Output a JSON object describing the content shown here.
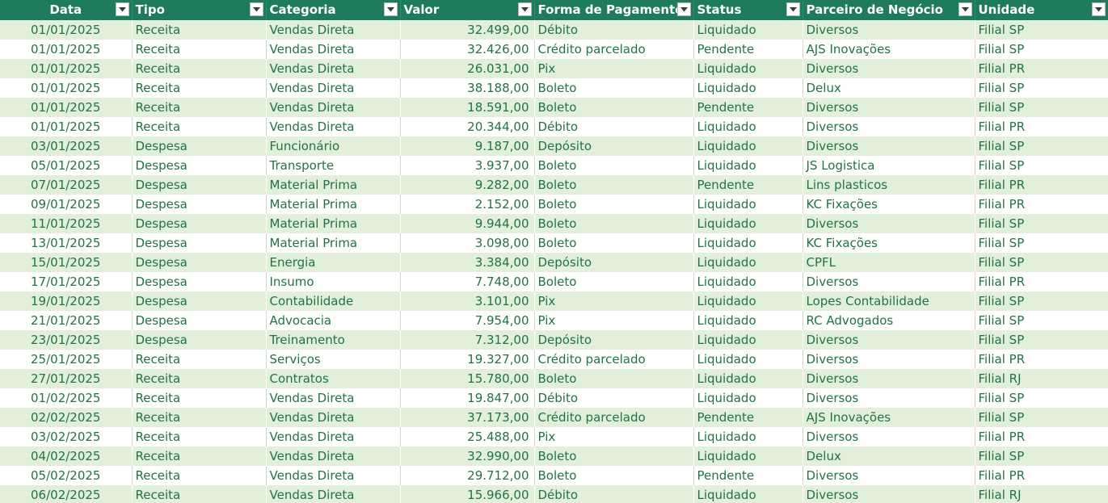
{
  "colors": {
    "header_bg": "#1e7b5e",
    "header_text": "#ffffff",
    "row_band": "#e2efda",
    "row_plain": "#ffffff",
    "cell_text": "#217346"
  },
  "table": {
    "headers": [
      "Data",
      "Tipo",
      "Categoria",
      "Valor",
      "Forma de Pagamento",
      "Status",
      "Parceiro de Negócio",
      "Unidade"
    ],
    "filter_icon": "dropdown-arrow-icon",
    "rows": [
      [
        "01/01/2025",
        "Receita",
        "Vendas Direta",
        "32.499,00",
        "Débito",
        "Liquidado",
        "Diversos",
        "Filial SP"
      ],
      [
        "01/01/2025",
        "Receita",
        "Vendas Direta",
        "32.426,00",
        "Crédito parcelado",
        "Pendente",
        "AJS Inovações",
        "Filial SP"
      ],
      [
        "01/01/2025",
        "Receita",
        "Vendas Direta",
        "26.031,00",
        "Pix",
        "Liquidado",
        "Diversos",
        "Filial PR"
      ],
      [
        "01/01/2025",
        "Receita",
        "Vendas Direta",
        "38.188,00",
        "Boleto",
        "Liquidado",
        "Delux",
        "Filial SP"
      ],
      [
        "01/01/2025",
        "Receita",
        "Vendas Direta",
        "18.591,00",
        "Boleto",
        "Pendente",
        "Diversos",
        "Filial SP"
      ],
      [
        "01/01/2025",
        "Receita",
        "Vendas Direta",
        "20.344,00",
        "Débito",
        "Liquidado",
        "Diversos",
        "Filial PR"
      ],
      [
        "03/01/2025",
        "Despesa",
        "Funcionário",
        "9.187,00",
        "Depósito",
        "Liquidado",
        "Diversos",
        "Filial SP"
      ],
      [
        "05/01/2025",
        "Despesa",
        "Transporte",
        "3.937,00",
        "Boleto",
        "Liquidado",
        "JS Logistica",
        "Filial SP"
      ],
      [
        "07/01/2025",
        "Despesa",
        "Material Prima",
        "9.282,00",
        "Boleto",
        "Pendente",
        "Lins plasticos",
        "Filial PR"
      ],
      [
        "09/01/2025",
        "Despesa",
        "Material Prima",
        "2.152,00",
        "Boleto",
        "Liquidado",
        "KC Fixações",
        "Filial PR"
      ],
      [
        "11/01/2025",
        "Despesa",
        "Material Prima",
        "9.944,00",
        "Boleto",
        "Liquidado",
        "Diversos",
        "Filial SP"
      ],
      [
        "13/01/2025",
        "Despesa",
        "Material Prima",
        "3.098,00",
        "Boleto",
        "Liquidado",
        "KC Fixações",
        "Filial SP"
      ],
      [
        "15/01/2025",
        "Despesa",
        "Energia",
        "3.384,00",
        "Depósito",
        "Liquidado",
        "CPFL",
        "Filial SP"
      ],
      [
        "17/01/2025",
        "Despesa",
        "Insumo",
        "7.748,00",
        "Boleto",
        "Liquidado",
        "Diversos",
        "Filial PR"
      ],
      [
        "19/01/2025",
        "Despesa",
        "Contabilidade",
        "3.101,00",
        "Pix",
        "Liquidado",
        "Lopes Contabilidade",
        "Filial SP"
      ],
      [
        "21/01/2025",
        "Despesa",
        "Advocacia",
        "7.954,00",
        "Pix",
        "Liquidado",
        "RC Advogados",
        "Filial SP"
      ],
      [
        "23/01/2025",
        "Despesa",
        "Treinamento",
        "7.312,00",
        "Depósito",
        "Liquidado",
        "Diversos",
        "Filial SP"
      ],
      [
        "25/01/2025",
        "Receita",
        "Serviços",
        "19.327,00",
        "Crédito parcelado",
        "Liquidado",
        "Diversos",
        "Filial PR"
      ],
      [
        "27/01/2025",
        "Receita",
        "Contratos",
        "15.780,00",
        "Boleto",
        "Liquidado",
        "Diversos",
        "Filial RJ"
      ],
      [
        "01/02/2025",
        "Receita",
        "Vendas Direta",
        "19.847,00",
        "Débito",
        "Liquidado",
        "Diversos",
        "Filial SP"
      ],
      [
        "02/02/2025",
        "Receita",
        "Vendas Direta",
        "37.173,00",
        "Crédito parcelado",
        "Pendente",
        "AJS Inovações",
        "Filial SP"
      ],
      [
        "03/02/2025",
        "Receita",
        "Vendas Direta",
        "25.488,00",
        "Pix",
        "Liquidado",
        "Diversos",
        "Filial PR"
      ],
      [
        "04/02/2025",
        "Receita",
        "Vendas Direta",
        "32.990,00",
        "Boleto",
        "Liquidado",
        "Delux",
        "Filial SP"
      ],
      [
        "05/02/2025",
        "Receita",
        "Vendas Direta",
        "29.712,00",
        "Boleto",
        "Pendente",
        "Diversos",
        "Filial PR"
      ],
      [
        "06/02/2025",
        "Receita",
        "Vendas Direta",
        "15.966,00",
        "Débito",
        "Liquidado",
        "Diversos",
        "Filial RJ"
      ]
    ]
  }
}
